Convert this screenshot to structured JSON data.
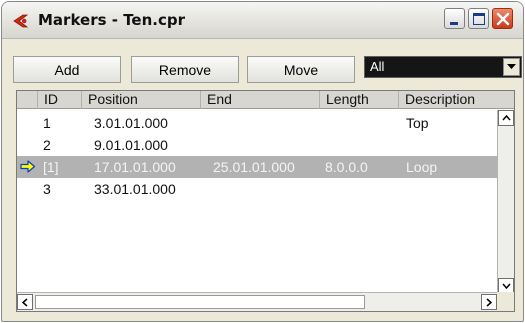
{
  "window": {
    "title": "Markers - Ten.cpr",
    "colors": {
      "accent": "#cc2200",
      "selection": "#b2b2b2",
      "dropdown_bg": "#151515"
    }
  },
  "toolbar": {
    "add_label": "Add",
    "remove_label": "Remove",
    "move_label": "Move",
    "filter": {
      "selected": "All"
    }
  },
  "table": {
    "columns": [
      "ID",
      "Position",
      "End",
      "Length",
      "Description"
    ],
    "rows": [
      {
        "id": "1",
        "position": "3.01.01.000",
        "end": "",
        "length": "",
        "description": "Top",
        "selected": false
      },
      {
        "id": "2",
        "position": "9.01.01.000",
        "end": "",
        "length": "",
        "description": "",
        "selected": false
      },
      {
        "id": "[1]",
        "position": "17.01.01.000",
        "end": "25.01.01.000",
        "length": "8.0.0.0",
        "description": "Loop",
        "selected": true
      },
      {
        "id": "3",
        "position": "33.01.01.000",
        "end": "",
        "length": "",
        "description": "",
        "selected": false
      }
    ]
  },
  "icons": {
    "app": "cubase-logo-icon",
    "current_row": "arrow-right-icon"
  }
}
